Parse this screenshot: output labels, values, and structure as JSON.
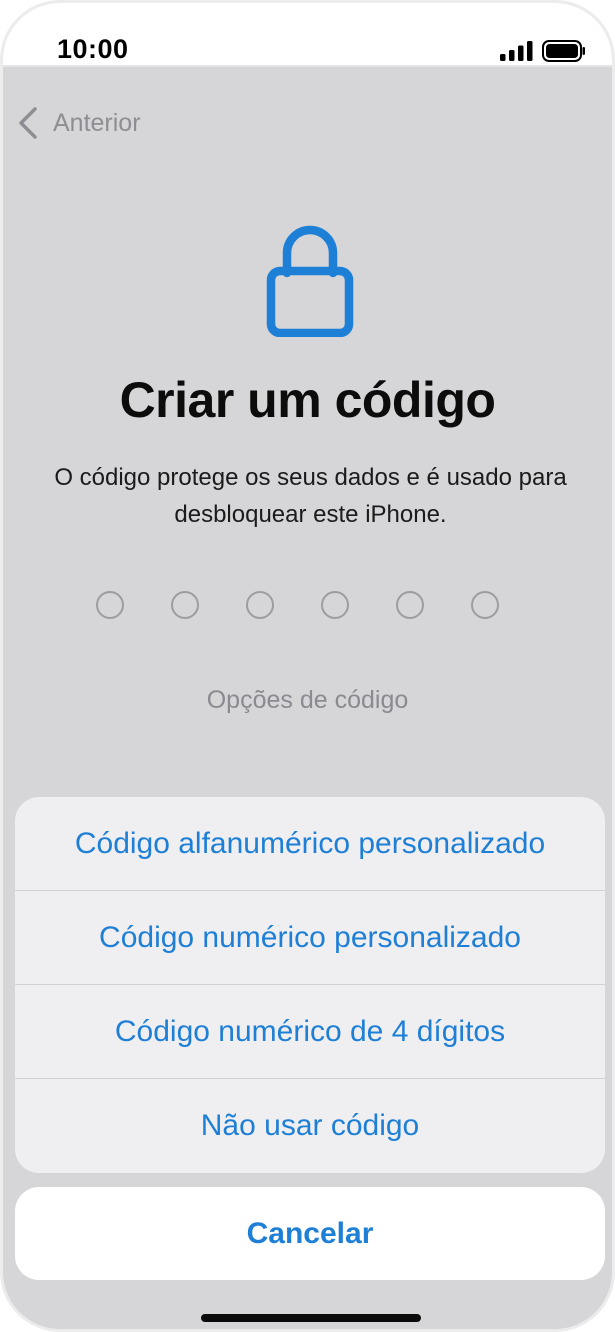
{
  "status_bar": {
    "time": "10:00"
  },
  "nav": {
    "back_label": "Anterior"
  },
  "page": {
    "title": "Criar um código",
    "subtitle": "O código protege os seus dados e é usado para desbloquear este iPhone.",
    "passcode_length": 6,
    "options_link": "Opções de código"
  },
  "action_sheet": {
    "items": [
      {
        "label": "Código alfanumérico personalizado"
      },
      {
        "label": "Código numérico personalizado"
      },
      {
        "label": "Código numérico de 4 dígitos"
      },
      {
        "label": "Não usar código"
      }
    ],
    "cancel_label": "Cancelar"
  },
  "colors": {
    "accent": "#1e7fd6",
    "dimmed_background": "#d6d5d8"
  },
  "icons": {
    "back": "chevron-left-icon",
    "lock": "lock-icon",
    "signal": "cellular-signal-icon",
    "battery": "battery-icon"
  }
}
